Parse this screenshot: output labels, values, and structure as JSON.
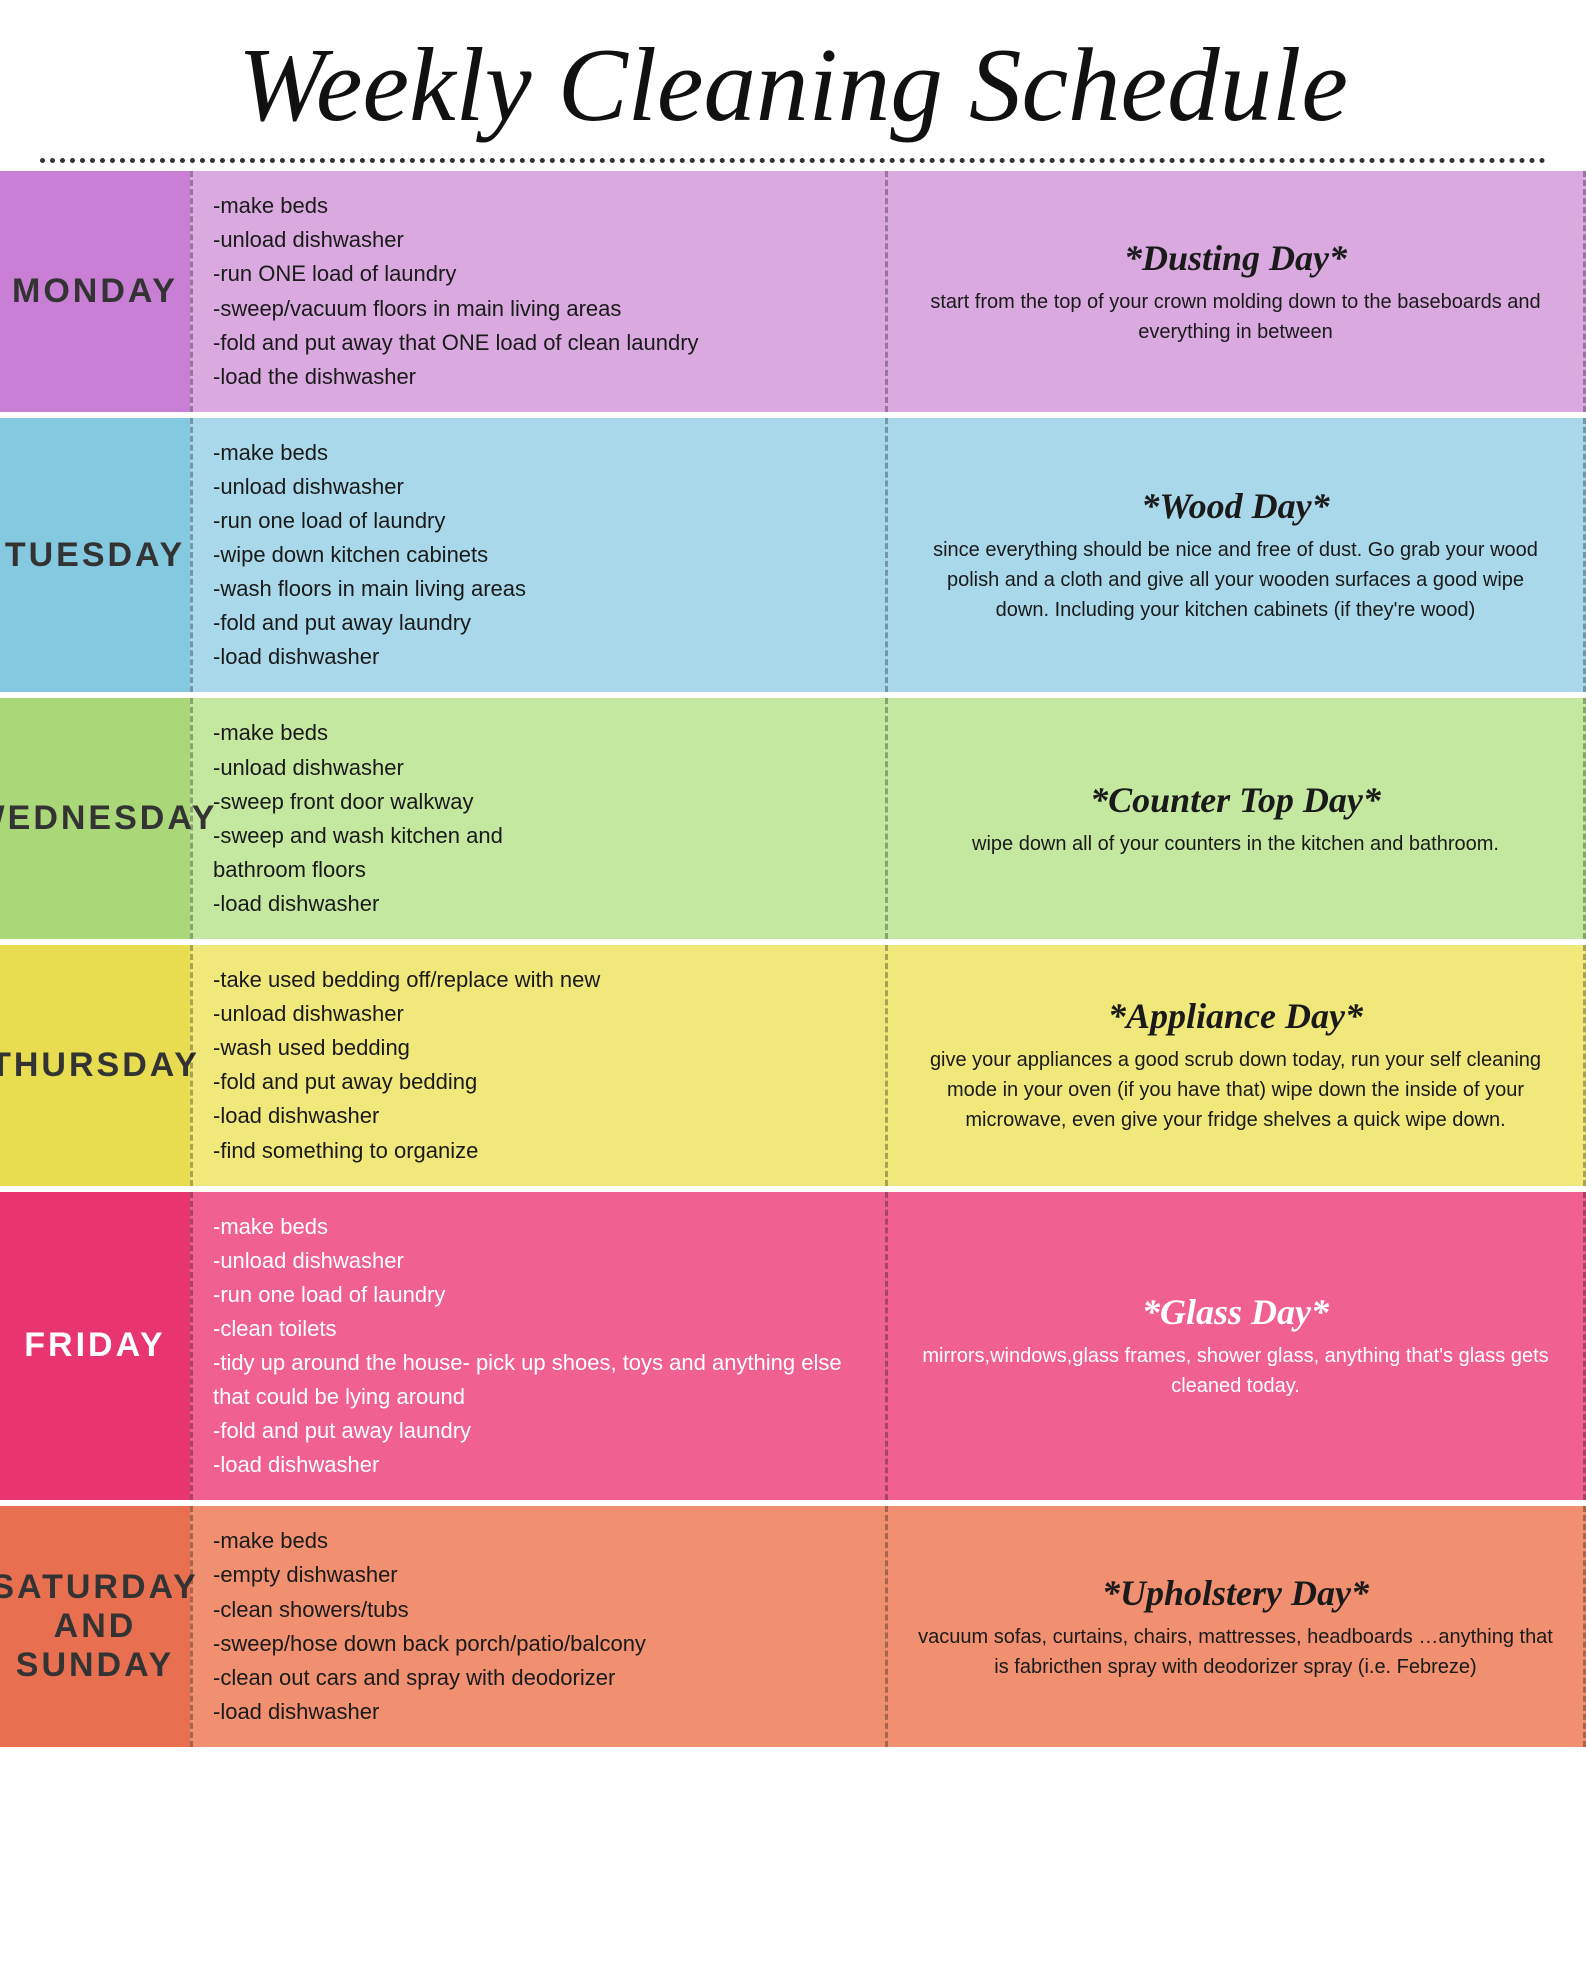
{
  "header": {
    "title": "Weekly Cleaning Schedule"
  },
  "days": [
    {
      "id": "monday",
      "label": "MONDAY",
      "color_class": "monday",
      "tasks": [
        "-make beds",
        "-unload dishwasher",
        "-run ONE load of laundry",
        "-sweep/vacuum floors in main living areas",
        "-fold and put away that ONE load of clean laundry",
        "-load the dishwasher"
      ],
      "special_title": "*Dusting Day*",
      "special_desc": "start from the top of your crown molding down to the baseboards and everything in between"
    },
    {
      "id": "tuesday",
      "label": "TUESDAY",
      "color_class": "tuesday",
      "tasks": [
        "-make beds",
        "-unload dishwasher",
        "-run one load of laundry",
        "-wipe down kitchen cabinets",
        "-wash floors in main living areas",
        "-fold and put away laundry",
        "-load dishwasher"
      ],
      "special_title": "*Wood Day*",
      "special_desc": "since everything should be nice and free of dust. Go grab your wood polish and a cloth and give all your wooden surfaces a good wipe down. Including your kitchen cabinets (if they're wood)"
    },
    {
      "id": "wednesday",
      "label": "WEDNESDAY",
      "color_class": "wednesday",
      "tasks": [
        "-make beds",
        "-unload dishwasher",
        "-sweep front door walkway",
        "-sweep and wash kitchen and\n bathroom floors",
        "-load dishwasher"
      ],
      "special_title": "*Counter Top Day*",
      "special_desc": "wipe down all of your counters in the kitchen and bathroom."
    },
    {
      "id": "thursday",
      "label": "THURSDAY",
      "color_class": "thursday",
      "tasks": [
        "-take used bedding off/replace with new",
        "-unload dishwasher",
        "-wash used bedding",
        "-fold and put away bedding",
        "-load dishwasher",
        "-find something to organize"
      ],
      "special_title": "*Appliance Day*",
      "special_desc": "give your appliances a good scrub down today, run your self cleaning mode in your oven (if you have that) wipe down the inside of your microwave, even give your fridge shelves a quick wipe down."
    },
    {
      "id": "friday",
      "label": "FRIDAY",
      "color_class": "friday",
      "tasks": [
        "-make beds",
        "-unload dishwasher",
        "-run one load of laundry",
        "-clean toilets",
        "-tidy up around the house- pick up shoes, toys and anything else that could be lying around",
        "-fold and put away laundry",
        "-load dishwasher"
      ],
      "special_title": "*Glass Day*",
      "special_desc": "mirrors,windows,glass frames, shower glass, anything that's glass gets cleaned today."
    },
    {
      "id": "saturday",
      "label": "SATURDAY\nAND\nSUNDAY",
      "color_class": "saturday",
      "tasks": [
        "-make beds",
        "-empty dishwasher",
        "-clean showers/tubs",
        "-sweep/hose down back porch/patio/balcony",
        "-clean out cars and spray with deodorizer",
        "-load dishwasher"
      ],
      "special_title": "*Upholstery Day*",
      "special_desc": "vacuum sofas, curtains, chairs, mattresses, headboards …anything that is fabricthen spray with deodorizer spray (i.e. Febreze)"
    }
  ]
}
